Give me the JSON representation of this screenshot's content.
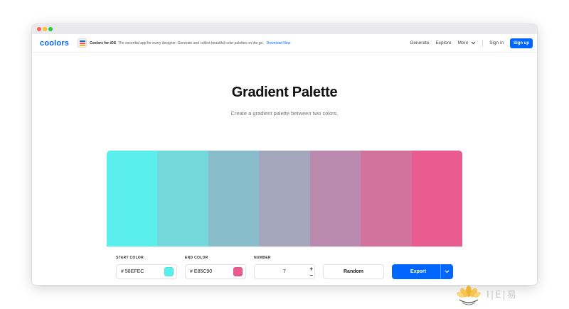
{
  "app": {
    "logo": "coolors"
  },
  "promo": {
    "title": "Coolors for iOS",
    "text": "The essential app for every designer. Generate and collect beautiful color palettes on the go.",
    "link": "Download Now"
  },
  "nav": {
    "generate": "Generate",
    "explore": "Explore",
    "more": "More",
    "signin": "Sign in",
    "signup": "Sign up"
  },
  "page": {
    "title": "Gradient Palette",
    "subtitle": "Create a gradient palette between two colors."
  },
  "palette": {
    "colors": [
      "#5AEFEC",
      "#73D8DA",
      "#8ABDCB",
      "#A3A6BC",
      "#BB8BAF",
      "#D2739D",
      "#E85C90"
    ]
  },
  "controls": {
    "start_label": "START COLOR",
    "start_value": "58EFEC",
    "start_color": "#58EFEC",
    "end_label": "END COLOR",
    "end_value": "E85C90",
    "end_color": "#E85C90",
    "number_label": "NUMBER",
    "number_value": "7",
    "hash": "#",
    "plus": "+",
    "minus": "−",
    "random": "Random",
    "export": "Export"
  },
  "icons": {
    "chevron": "chevron-down-icon",
    "wm_emblem": "lotus-emblem"
  },
  "watermark": {
    "text": "I|E|易"
  }
}
